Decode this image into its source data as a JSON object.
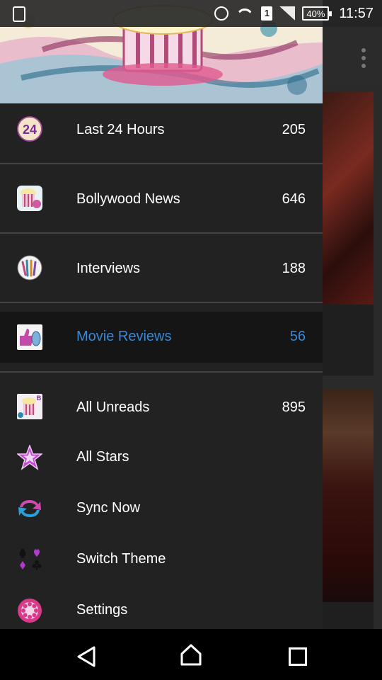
{
  "status_bar": {
    "sim_slot": "1",
    "battery": "40%",
    "time": "11:57"
  },
  "drawer": {
    "items": [
      {
        "label": "Last 24 Hours",
        "count": "205",
        "icon": "24-icon"
      },
      {
        "label": "Bollywood News",
        "count": "646",
        "icon": "popcorn-icon"
      },
      {
        "label": "Interviews",
        "count": "188",
        "icon": "microphone-icon"
      },
      {
        "label": "Movie Reviews",
        "count": "56",
        "icon": "thumbs-icon",
        "selected": true
      },
      {
        "label": "All Unreads",
        "count": "895",
        "icon": "popcorn-reels-icon"
      },
      {
        "label": "All Stars",
        "icon": "star-icon"
      },
      {
        "label": "Sync Now",
        "icon": "sync-icon"
      },
      {
        "label": "Switch Theme",
        "icon": "card-suits-icon"
      },
      {
        "label": "Settings",
        "icon": "gear-icon"
      }
    ]
  },
  "colors": {
    "drawer_bg": "#222222",
    "selected_text": "#3a87d6",
    "selected_bg": "#151515"
  }
}
